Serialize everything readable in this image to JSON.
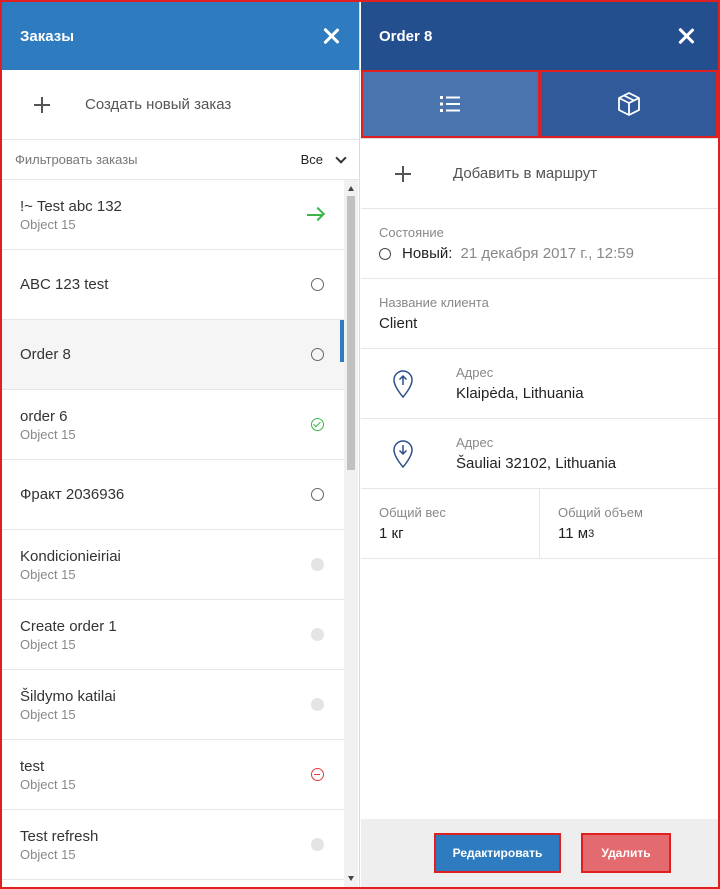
{
  "orders_panel": {
    "title": "Заказы",
    "create_label": "Создать новый заказ",
    "filter_label": "Фильтровать заказы",
    "filter_value": "Все",
    "items": [
      {
        "title": "!~ Test abc 132",
        "subtitle": "Object 15",
        "status": "in-progress-icon"
      },
      {
        "title": "ABC 123 test",
        "subtitle": "",
        "status": "new-status-icon"
      },
      {
        "title": "Order 8",
        "subtitle": "",
        "status": "new-status-icon",
        "selected": true
      },
      {
        "title": "order 6",
        "subtitle": "Object 15",
        "status": "completed-status-icon"
      },
      {
        "title": "Фракт 2036936",
        "subtitle": "",
        "status": "new-status-icon"
      },
      {
        "title": "Kondicionieiriai",
        "subtitle": "Object 15",
        "status": "inactive-status-icon"
      },
      {
        "title": "Create order 1",
        "subtitle": "Object 15",
        "status": "inactive-status-icon"
      },
      {
        "title": "Šildymo katilai",
        "subtitle": "Object 15",
        "status": "inactive-status-icon"
      },
      {
        "title": "test",
        "subtitle": "Object 15",
        "status": "cancelled-status-icon"
      },
      {
        "title": "Test refresh",
        "subtitle": "Object 15",
        "status": "inactive-status-icon"
      }
    ]
  },
  "detail_panel": {
    "title": "Order 8",
    "add_route_label": "Добавить в маршрут",
    "state": {
      "label": "Состояние",
      "value": "Новый:",
      "date": "21 декабря 2017 г., 12:59"
    },
    "client": {
      "label": "Название клиента",
      "value": "Client"
    },
    "pickup_address": {
      "label": "Адрес",
      "value": "Klaipėda, Lithuania"
    },
    "delivery_address": {
      "label": "Адрес",
      "value": "Šauliai 32102, Lithuania"
    },
    "total_weight": {
      "label": "Общий вес",
      "value": "1 кг"
    },
    "total_volume": {
      "label": "Общий объем",
      "value": "11 м",
      "unit_power": "3"
    },
    "edit_button": "Редактировать",
    "delete_button": "Удалить"
  },
  "colors": {
    "left_header": "#2f7bbf",
    "right_header": "#234f8f",
    "tab_active": "#4a74ae",
    "edit_button": "#2f7bbf",
    "delete_button": "#e36a6f",
    "highlight_border": "#e02020"
  }
}
